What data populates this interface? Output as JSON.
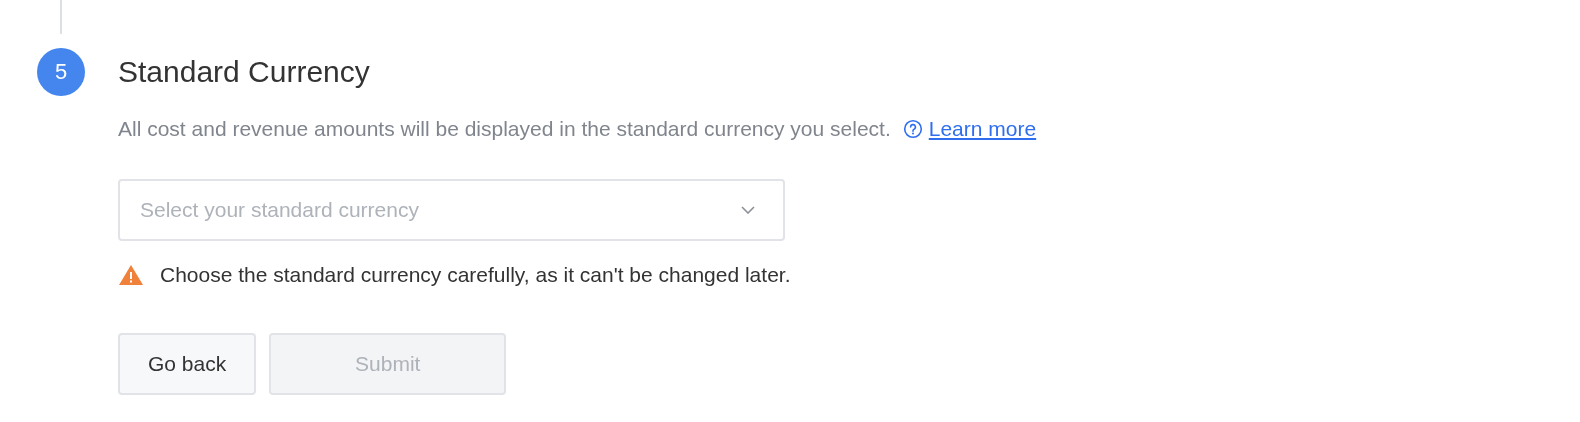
{
  "step": {
    "number": "5",
    "title": "Standard Currency"
  },
  "description": "All cost and revenue amounts will be displayed in the standard currency you select.",
  "help_link": "Learn more",
  "currency_select": {
    "placeholder": "Select your standard currency"
  },
  "warning": "Choose the standard currency carefully, as it can't be changed later.",
  "buttons": [
    {
      "label": "Go back",
      "disabled": false
    },
    {
      "label": "Submit",
      "disabled": true
    }
  ]
}
